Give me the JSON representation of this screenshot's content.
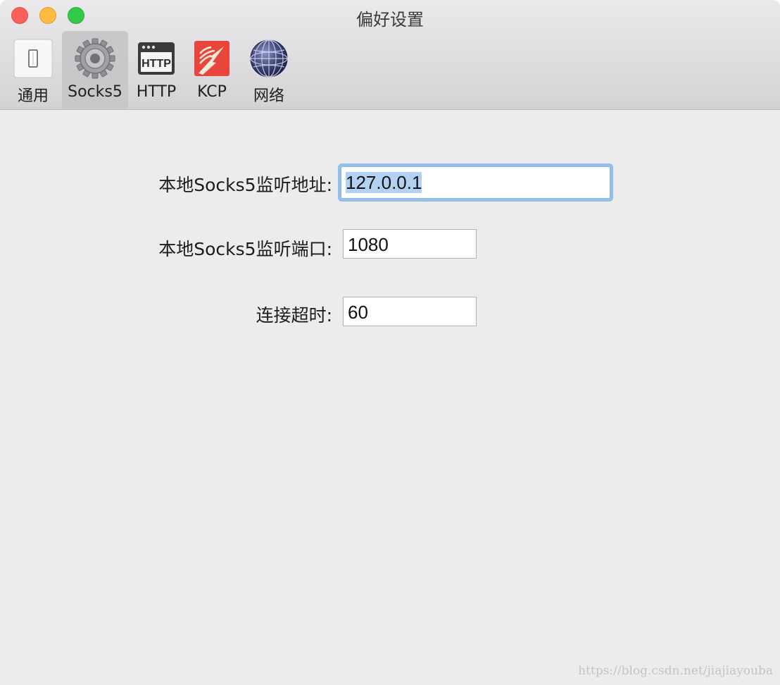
{
  "window": {
    "title": "偏好设置"
  },
  "toolbar": {
    "tabs": [
      {
        "label": "通用",
        "icon": "switch-icon",
        "active": false
      },
      {
        "label": "Socks5",
        "icon": "gear-icon",
        "active": true
      },
      {
        "label": "HTTP",
        "icon": "http-icon",
        "active": false
      },
      {
        "label": "KCP",
        "icon": "kcp-icon",
        "active": false
      },
      {
        "label": "网络",
        "icon": "globe-icon",
        "active": false
      }
    ],
    "http_icon_text": "HTTP"
  },
  "form": {
    "address_label": "本地Socks5监听地址:",
    "address_value": "127.0.0.1",
    "port_label": "本地Socks5监听端口:",
    "port_value": "1080",
    "timeout_label": "连接超时:",
    "timeout_value": "60"
  },
  "watermark": "https://blog.csdn.net/jiajiayouba",
  "colors": {
    "focus_ring": "#94bfe9",
    "selection": "#b3d2f3",
    "close": "#fc605c",
    "minimize": "#fdbc40",
    "zoom": "#34c84a",
    "kcp_icon": "#e8453c"
  }
}
